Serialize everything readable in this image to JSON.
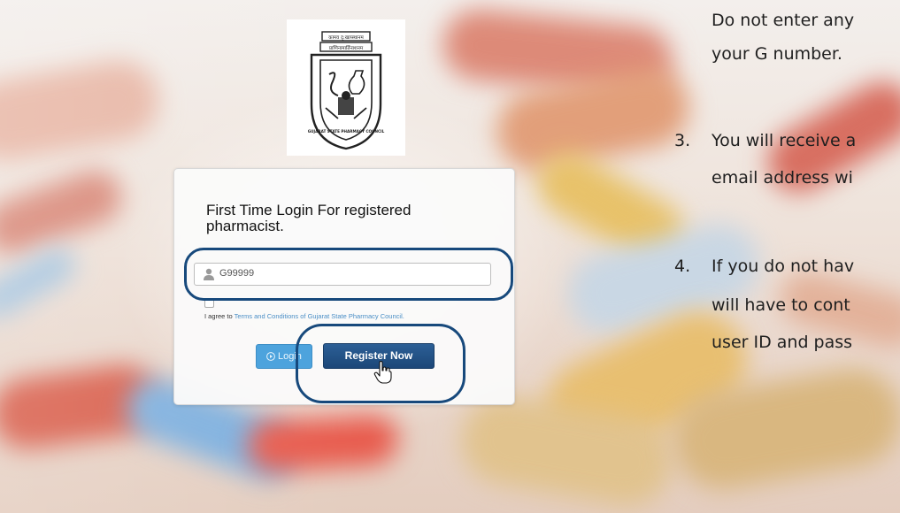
{
  "logo": {
    "alt": "Gujarat State Pharmacy Council emblem",
    "banner_text_top": "कामव दृ:खाय्स्थानम",
    "banner_text_bottom": "प्राणिनामार्तिनाशनम",
    "ring_text": "GUJARAT STATE PHARMACY COUNCIL"
  },
  "login": {
    "title": "First Time Login For registered pharmacist.",
    "username_value": "G99999",
    "username_placeholder": "G99999",
    "terms_prefix": "I agree to ",
    "terms_link": "Terms and Conditions of Gujarat State Pharmacy Council.",
    "login_button": "Login",
    "register_button": "Register Now"
  },
  "instructions": {
    "lines": [
      "Do not enter any",
      "your G number.",
      "You will receive a",
      "email address wi",
      "If you do not hav",
      "will have to cont",
      "user ID and pass"
    ],
    "numbers": [
      "3.",
      "4."
    ]
  },
  "colors": {
    "highlight": "#17497c",
    "register_button": "#1f4b7d",
    "login_button": "#4da3dd",
    "link": "#4a8ec6"
  },
  "icons": {
    "user": "user-icon",
    "login": "play-circle-icon",
    "cursor": "hand-pointer-icon"
  }
}
